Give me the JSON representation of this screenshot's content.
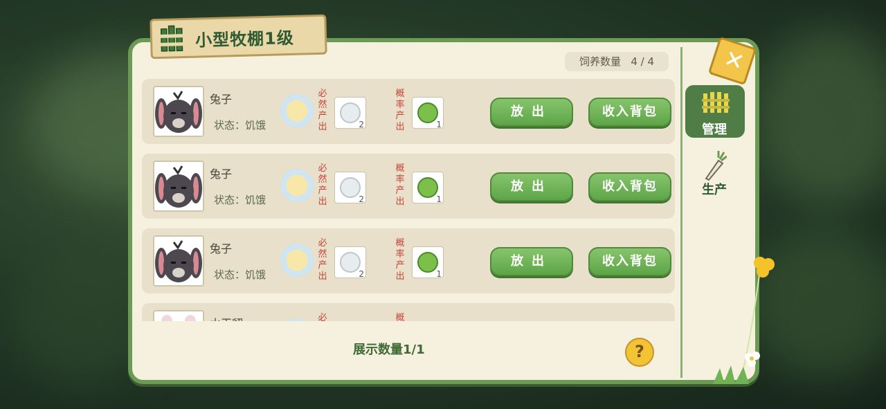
{
  "title": "小型牧棚1级",
  "feed_count_label": "饲养数量",
  "feed_count_value": "4 / 4",
  "labels": {
    "guaranteed_output": "必然产出",
    "chance_output": "概率产出"
  },
  "buttons": {
    "release": "放出",
    "stash": "收入背包",
    "help": "?"
  },
  "rows": [
    {
      "name": "兔子",
      "status": "状态：饥饿",
      "guaranteed_count": "2",
      "chance_count": "1"
    },
    {
      "name": "兔子",
      "status": "状态：饥饿",
      "guaranteed_count": "2",
      "chance_count": "1"
    },
    {
      "name": "兔子",
      "status": "状态：饥饿",
      "guaranteed_count": "2",
      "chance_count": "1"
    },
    {
      "name": "水玉貂",
      "status": "",
      "guaranteed_count": "",
      "chance_count": ""
    }
  ],
  "footer": {
    "display_count": "展示数量1/1"
  },
  "side_tabs": [
    {
      "label": "管理",
      "icon": "fence-icon",
      "active": true
    },
    {
      "label": "生产",
      "icon": "carrot-icon",
      "active": false
    }
  ],
  "colors": {
    "panel_border": "#6b9a55",
    "button_green": "#6fb355",
    "warning_red": "#c8453b",
    "help_yellow": "#f2c335"
  }
}
